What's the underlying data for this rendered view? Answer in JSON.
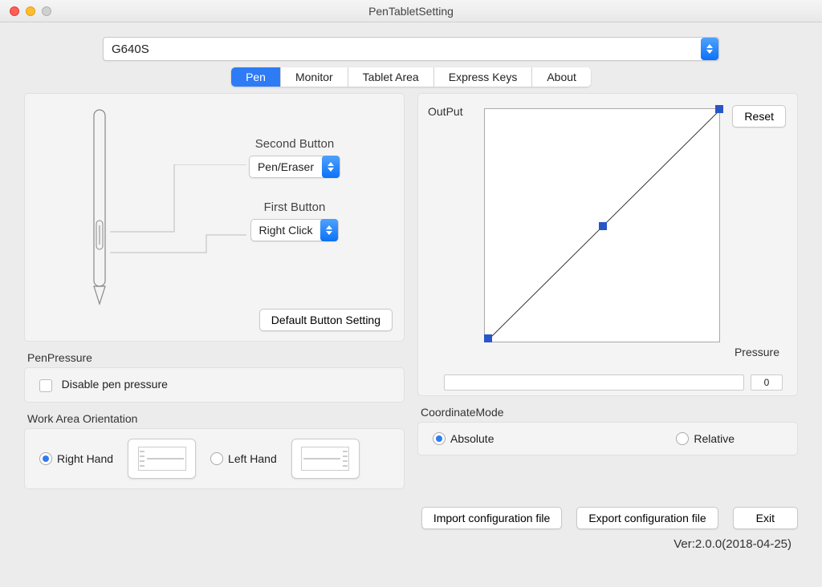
{
  "window": {
    "title": "PenTabletSetting"
  },
  "device": {
    "selected": "G640S"
  },
  "tabs": [
    "Pen",
    "Monitor",
    "Tablet Area",
    "Express Keys",
    "About"
  ],
  "active_tab": 0,
  "pen": {
    "second_button": {
      "label": "Second Button",
      "value": "Pen/Eraser"
    },
    "first_button": {
      "label": "First Button",
      "value": "Right Click"
    },
    "default_button": "Default  Button Setting"
  },
  "curve": {
    "output_label": "OutPut",
    "pressure_label": "Pressure",
    "reset": "Reset",
    "value": "0"
  },
  "pen_pressure": {
    "title": "PenPressure",
    "disable_label": "Disable pen pressure",
    "disabled": false
  },
  "orientation": {
    "title": "Work Area Orientation",
    "right": "Right Hand",
    "left": "Left Hand",
    "selected": "right"
  },
  "coord": {
    "title": "CoordinateMode",
    "absolute": "Absolute",
    "relative": "Relative",
    "selected": "absolute"
  },
  "footer": {
    "import": "Import configuration file",
    "export": "Export configuration file",
    "exit": "Exit"
  },
  "version": "Ver:2.0.0(2018-04-25)",
  "chart_data": {
    "type": "line",
    "title": "Pressure curve",
    "xlabel": "Pressure",
    "ylabel": "OutPut",
    "xlim": [
      0,
      1
    ],
    "ylim": [
      0,
      1
    ],
    "x": [
      0,
      0.5,
      1
    ],
    "y": [
      0,
      0.5,
      1
    ]
  }
}
